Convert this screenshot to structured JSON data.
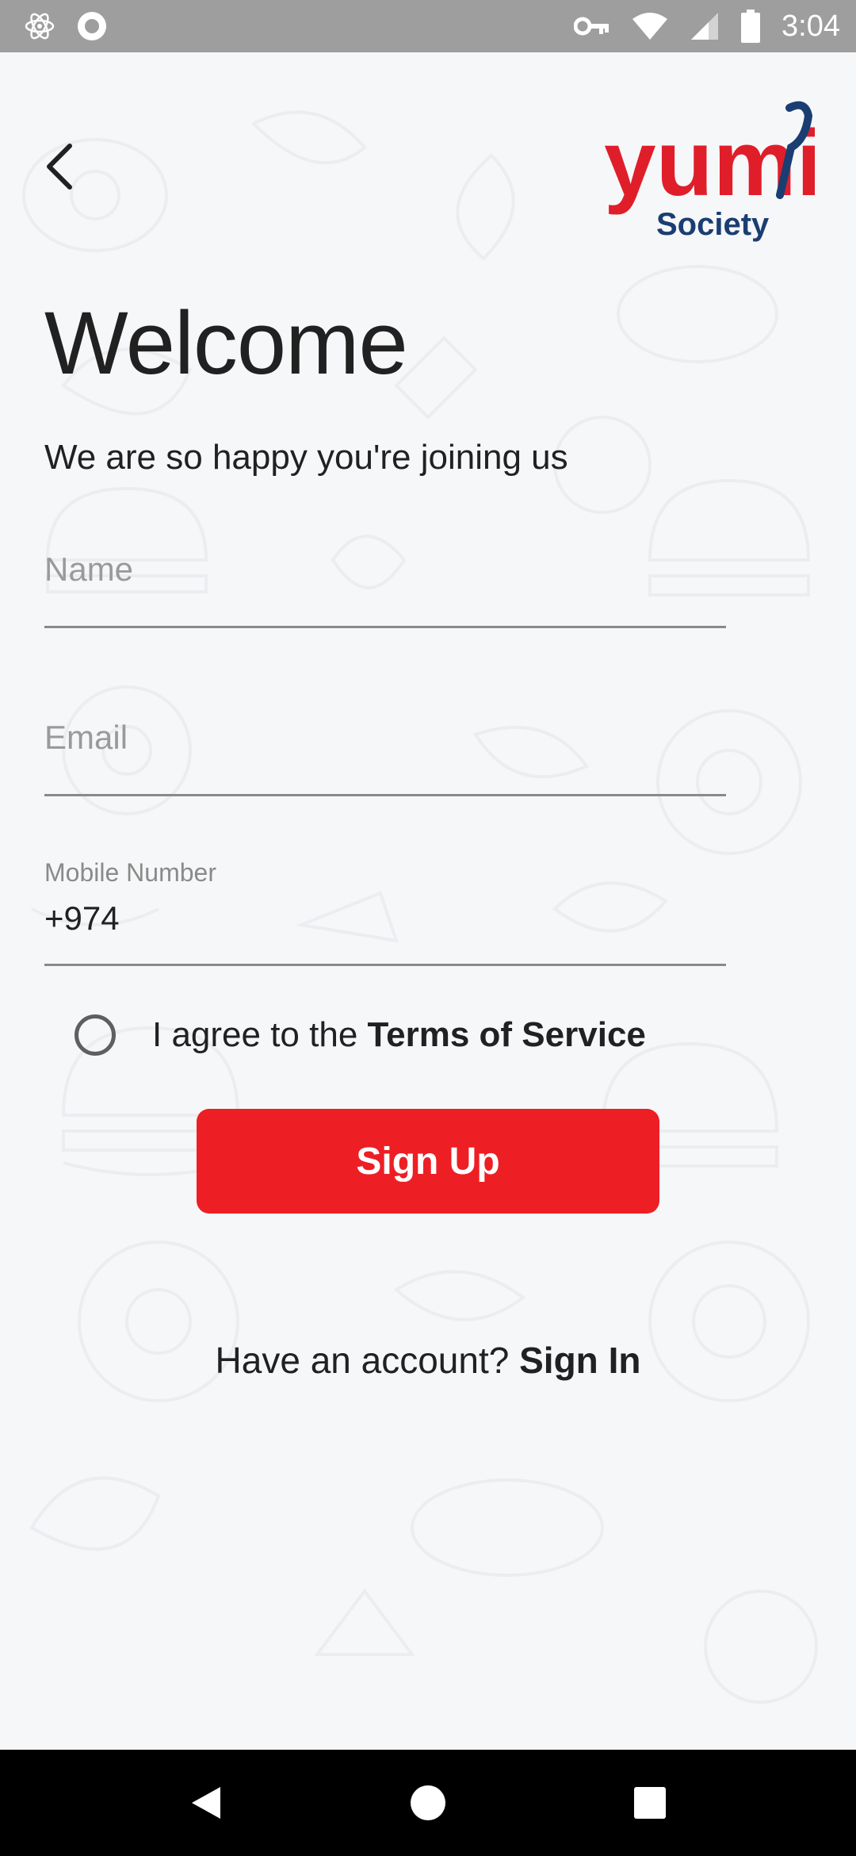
{
  "status_bar": {
    "time": "3:04",
    "icons": [
      "atom-icon",
      "circle-record-icon",
      "key-icon",
      "wifi-icon",
      "signal-icon",
      "battery-icon"
    ]
  },
  "header": {
    "back_icon": "chevron-left-icon",
    "logo": {
      "word": "yumi",
      "tagline": "Society",
      "brand_red": "#e01e2a",
      "brand_navy": "#1a3e72"
    }
  },
  "welcome": {
    "title": "Welcome",
    "subtitle": "We are so happy you're joining us"
  },
  "form": {
    "name": {
      "placeholder": "Name",
      "value": ""
    },
    "email": {
      "placeholder": "Email",
      "value": ""
    },
    "mobile": {
      "label": "Mobile Number",
      "value": "+974"
    },
    "terms": {
      "prefix": "I agree to the ",
      "link": "Terms of Service",
      "checked": false
    },
    "signup_label": "Sign Up"
  },
  "footer": {
    "prompt": "Have an account? ",
    "signin_label": "Sign In"
  },
  "nav_bar": {
    "icons": [
      "back-triangle-icon",
      "home-circle-icon",
      "recents-square-icon"
    ]
  },
  "colors": {
    "accent": "#ed1f24",
    "text": "#212121",
    "placeholder": "#9a9a9a",
    "background": "#f6f7f9"
  }
}
